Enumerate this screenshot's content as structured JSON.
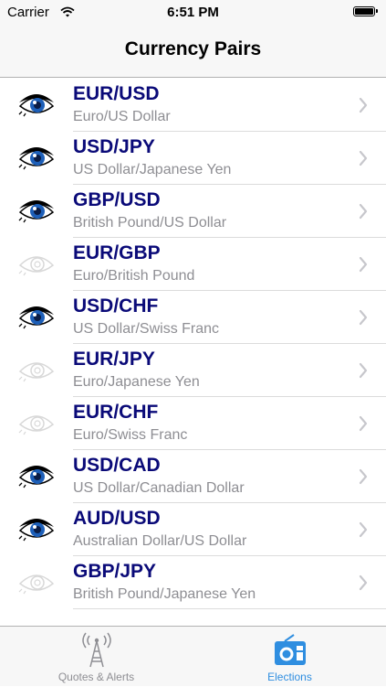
{
  "status_bar": {
    "carrier": "Carrier",
    "time": "6:51 PM",
    "wifi_icon": "wifi-icon",
    "battery_icon": "battery-icon"
  },
  "nav": {
    "title": "Currency Pairs"
  },
  "colors": {
    "pair_code": "#0a0a78",
    "pair_name": "#8e8e93",
    "eye_active_iris": "#1d5fb8",
    "eye_inactive": "#d8d8d8",
    "tab_selected": "#2f8ee0",
    "tab_unselected": "#8e8e93"
  },
  "pairs": [
    {
      "code": "EUR/USD",
      "name": "Euro/US Dollar",
      "watched": true
    },
    {
      "code": "USD/JPY",
      "name": "US Dollar/Japanese Yen",
      "watched": true
    },
    {
      "code": "GBP/USD",
      "name": "British Pound/US Dollar",
      "watched": true
    },
    {
      "code": "EUR/GBP",
      "name": "Euro/British Pound",
      "watched": false
    },
    {
      "code": "USD/CHF",
      "name": "US Dollar/Swiss Franc",
      "watched": true
    },
    {
      "code": "EUR/JPY",
      "name": "Euro/Japanese Yen",
      "watched": false
    },
    {
      "code": "EUR/CHF",
      "name": "Euro/Swiss Franc",
      "watched": false
    },
    {
      "code": "USD/CAD",
      "name": "US Dollar/Canadian Dollar",
      "watched": true
    },
    {
      "code": "AUD/USD",
      "name": "Australian Dollar/US Dollar",
      "watched": true
    },
    {
      "code": "GBP/JPY",
      "name": "British Pound/Japanese Yen",
      "watched": false
    }
  ],
  "tabs": [
    {
      "label": "Quotes & Alerts",
      "icon": "antenna-tower-icon",
      "selected": false
    },
    {
      "label": "Elections",
      "icon": "radio-icon",
      "selected": true
    }
  ]
}
